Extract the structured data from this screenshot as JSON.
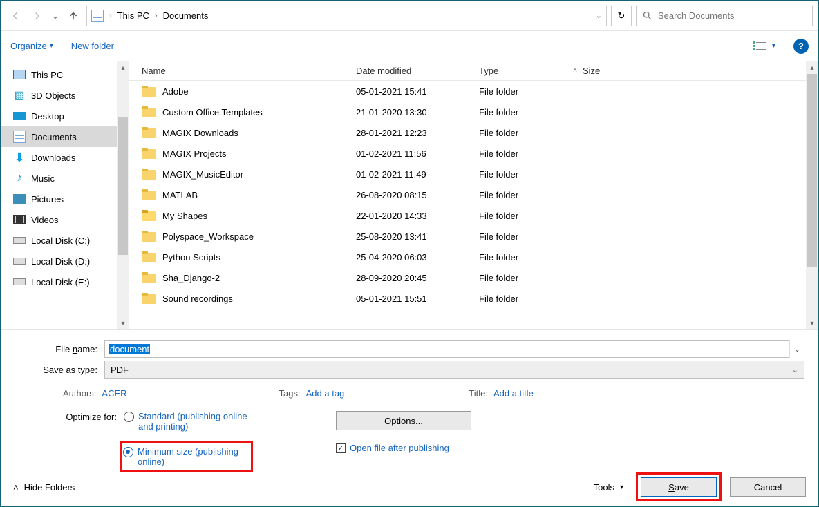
{
  "breadcrumb": {
    "root": "This PC",
    "folder": "Documents"
  },
  "search": {
    "placeholder": "Search Documents"
  },
  "toolbar": {
    "organize": "Organize",
    "new_folder": "New folder"
  },
  "columns": {
    "name": "Name",
    "date": "Date modified",
    "type": "Type",
    "size": "Size"
  },
  "sidebar": {
    "items": [
      {
        "label": "This PC",
        "icon": "pc"
      },
      {
        "label": "3D Objects",
        "icon": "3d"
      },
      {
        "label": "Desktop",
        "icon": "desktop"
      },
      {
        "label": "Documents",
        "icon": "doc",
        "selected": true
      },
      {
        "label": "Downloads",
        "icon": "download"
      },
      {
        "label": "Music",
        "icon": "music"
      },
      {
        "label": "Pictures",
        "icon": "pictures"
      },
      {
        "label": "Videos",
        "icon": "videos"
      },
      {
        "label": "Local Disk (C:)",
        "icon": "drive"
      },
      {
        "label": "Local Disk (D:)",
        "icon": "drive"
      },
      {
        "label": "Local Disk (E:)",
        "icon": "drive"
      }
    ]
  },
  "files": [
    {
      "name": "Adobe",
      "date": "05-01-2021 15:41",
      "type": "File folder"
    },
    {
      "name": "Custom Office Templates",
      "date": "21-01-2020 13:30",
      "type": "File folder"
    },
    {
      "name": "MAGIX Downloads",
      "date": "28-01-2021 12:23",
      "type": "File folder"
    },
    {
      "name": "MAGIX Projects",
      "date": "01-02-2021 11:56",
      "type": "File folder"
    },
    {
      "name": "MAGIX_MusicEditor",
      "date": "01-02-2021 11:49",
      "type": "File folder"
    },
    {
      "name": "MATLAB",
      "date": "26-08-2020 08:15",
      "type": "File folder"
    },
    {
      "name": "My Shapes",
      "date": "22-01-2020 14:33",
      "type": "File folder",
      "fancy": true
    },
    {
      "name": "Polyspace_Workspace",
      "date": "25-08-2020 13:41",
      "type": "File folder"
    },
    {
      "name": "Python Scripts",
      "date": "25-04-2020 06:03",
      "type": "File folder"
    },
    {
      "name": "Sha_Django-2",
      "date": "28-09-2020 20:45",
      "type": "File folder"
    },
    {
      "name": "Sound recordings",
      "date": "05-01-2021 15:51",
      "type": "File folder"
    }
  ],
  "form": {
    "filename_label": "File name:",
    "filename_value": "document",
    "type_label": "Save as type:",
    "type_value": "PDF",
    "authors_label": "Authors:",
    "authors_value": "ACER",
    "tags_label": "Tags:",
    "tags_value": "Add a tag",
    "title_label": "Title:",
    "title_value": "Add a title",
    "optimize_label": "Optimize for:",
    "radio_standard": "Standard (publishing online and printing)",
    "radio_minimum": "Minimum size (publishing online)",
    "options_button": "Options...",
    "openafter": "Open file after publishing"
  },
  "footer": {
    "hide": "Hide Folders",
    "tools": "Tools",
    "save": "Save",
    "cancel": "Cancel"
  }
}
